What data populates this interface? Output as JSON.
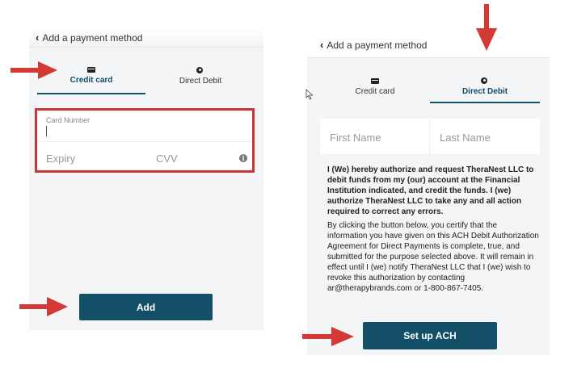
{
  "left": {
    "header": {
      "back_label": "Add a payment method"
    },
    "tabs": {
      "credit": "Credit card",
      "debit": "Direct Debit"
    },
    "form": {
      "card_number_label": "Card Number",
      "expiry_placeholder": "Expiry",
      "cvv_placeholder": "CVV"
    },
    "add_button": "Add"
  },
  "right": {
    "header": {
      "back_label": "Add a payment method"
    },
    "tabs": {
      "credit": "Credit card",
      "debit": "Direct Debit"
    },
    "form": {
      "first_name_placeholder": "First Name",
      "last_name_placeholder": "Last Name"
    },
    "consent_bold": "I (We) hereby authorize and request TheraNest LLC to debit funds from my (our) account at the Financial Institution indicated, and credit the funds. I (we) authorize TheraNest LLC to take any and all action required to correct any errors.",
    "consent_body": "By clicking the button below, you certify that the information you have given on this ACH Debit Authorization Agreement for Direct Payments is complete, true, and submitted for the purpose selected above. It will remain in effect until I (we) notify TheraNest LLC that I (we) wish to revoke this authorization by contacting ar@therapybrands.com or 1-800-867-7405.",
    "setup_button": "Set up ACH"
  },
  "colors": {
    "accent": "#134f67",
    "annotation_red": "#d43a35"
  },
  "icons": [
    "chevron-left-icon",
    "credit-card-icon",
    "direct-debit-icon",
    "info-icon",
    "arrow-annotation-icon"
  ]
}
